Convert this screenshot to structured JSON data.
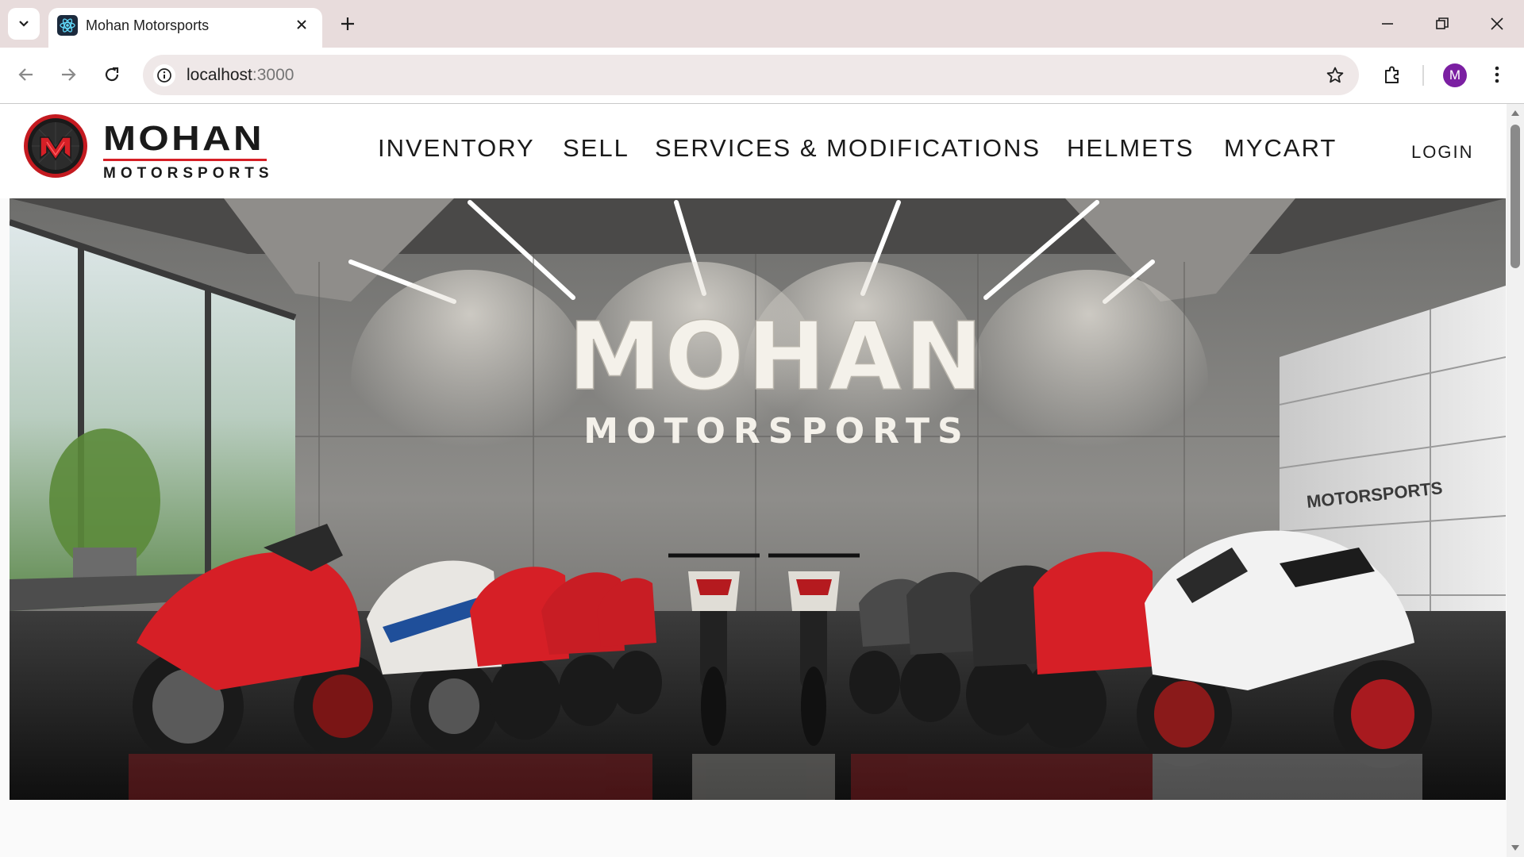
{
  "browser": {
    "tab_title": "Mohan Motorsports",
    "url_host": "localhost",
    "url_port": ":3000",
    "profile_initial": "M"
  },
  "site": {
    "logo": {
      "main": "MOHAN",
      "sub": "MOTORSPORTS"
    },
    "nav": [
      "INVENTORY",
      "SELL",
      "SERVICES & MODIFICATIONS",
      "HELMETS",
      "MYCART"
    ],
    "login_label": "LOGIN",
    "hero": {
      "title": "MOHAN",
      "subtitle": "MOTORSPORTS",
      "door_text": "MOTORSPORTS"
    }
  },
  "colors": {
    "brand_red": "#d61f26",
    "tabstrip": "#e8dcdc",
    "avatar": "#7b1fa2"
  },
  "icons": [
    "tab-search-icon",
    "react-favicon-icon",
    "close-icon",
    "plus-icon",
    "minimize-icon",
    "restore-icon",
    "window-close-icon",
    "back-arrow-icon",
    "forward-arrow-icon",
    "reload-icon",
    "site-info-icon",
    "star-icon",
    "extensions-icon",
    "kebab-menu-icon"
  ]
}
